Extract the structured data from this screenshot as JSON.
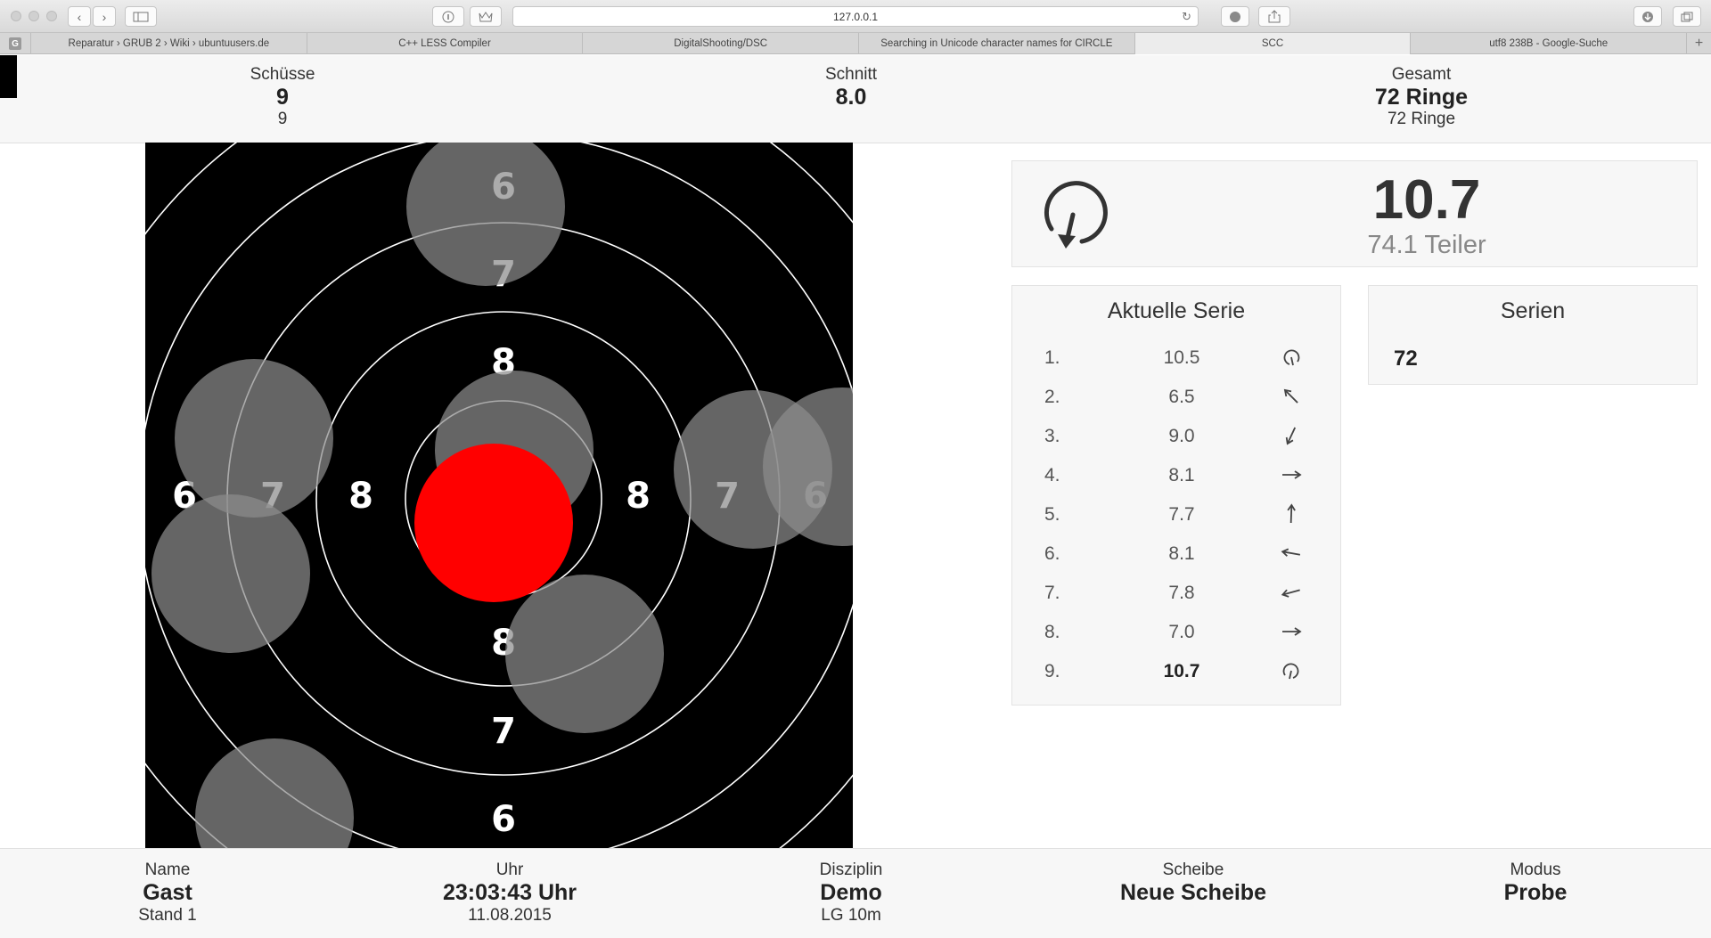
{
  "browser": {
    "url": "127.0.0.1",
    "tabs": [
      {
        "label": "Reparatur › GRUB 2 › Wiki › ubuntuusers.de",
        "active": false
      },
      {
        "label": "C++ LESS Compiler",
        "active": false
      },
      {
        "label": "DigitalShooting/DSC",
        "active": false
      },
      {
        "label": "Searching in Unicode character names for CIRCLE",
        "active": false
      },
      {
        "label": "SCC",
        "active": true
      },
      {
        "label": "utf8 238B - Google-Suche",
        "active": false
      }
    ],
    "favicon_letter": "G",
    "add_tab": "+"
  },
  "stats": {
    "shots": {
      "label": "Schüsse",
      "value": "9",
      "sub": "9"
    },
    "average": {
      "label": "Schnitt",
      "value": "8.0"
    },
    "total": {
      "label": "Gesamt",
      "value": "72 Ringe",
      "sub": "72 Ringe"
    }
  },
  "target": {
    "ring_labels": [
      "6",
      "7",
      "8"
    ],
    "hit_color": "#ff0000",
    "shot_color": "#8c8c8c"
  },
  "last_shot": {
    "value": "10.7",
    "teiler": "74.1 Teiler",
    "direction_icon": "clockwise-arrow-icon"
  },
  "current_series": {
    "title": "Aktuelle Serie",
    "rows": [
      {
        "num": "1.",
        "value": "10.5",
        "icon": "counterclockwise-circle-icon",
        "angle": 0,
        "bold": false
      },
      {
        "num": "2.",
        "value": "6.5",
        "icon": "arrow-down-left-icon",
        "angle": 225,
        "bold": false
      },
      {
        "num": "3.",
        "value": "9.0",
        "icon": "arrow-down-right-icon",
        "angle": 115,
        "bold": false
      },
      {
        "num": "4.",
        "value": "8.1",
        "icon": "arrow-right-icon",
        "angle": 0,
        "bold": false
      },
      {
        "num": "5.",
        "value": "7.7",
        "icon": "arrow-up-icon",
        "angle": 272,
        "bold": false
      },
      {
        "num": "6.",
        "value": "8.1",
        "icon": "arrow-left-icon",
        "angle": 190,
        "bold": false
      },
      {
        "num": "7.",
        "value": "7.8",
        "icon": "arrow-left-down-icon",
        "angle": 165,
        "bold": false
      },
      {
        "num": "8.",
        "value": "7.0",
        "icon": "arrow-right-icon",
        "angle": 0,
        "bold": false
      },
      {
        "num": "9.",
        "value": "10.7",
        "icon": "clockwise-circle-icon",
        "angle": 0,
        "bold": true
      }
    ]
  },
  "series": {
    "title": "Serien",
    "values": [
      "72"
    ]
  },
  "info": {
    "name": {
      "label": "Name",
      "value": "Gast",
      "sub": "Stand 1"
    },
    "clock": {
      "label": "Uhr",
      "value": "23:03:43 Uhr",
      "sub": "11.08.2015"
    },
    "discipline": {
      "label": "Disziplin",
      "value": "Demo",
      "sub": "LG 10m"
    },
    "target": {
      "label": "Scheibe",
      "value": "Neue Scheibe"
    },
    "mode": {
      "label": "Modus",
      "value": "Probe"
    }
  }
}
